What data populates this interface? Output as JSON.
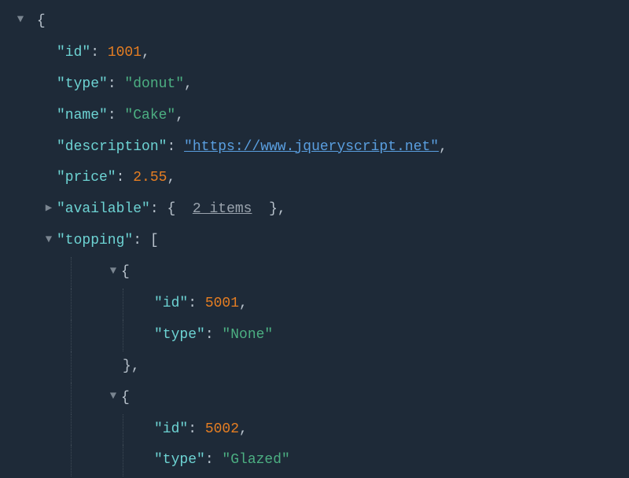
{
  "root": {
    "open_brace": "{",
    "entries": [
      {
        "key": "\"id\"",
        "sep": ": ",
        "value": "1001",
        "valueClass": "num",
        "comma": ","
      },
      {
        "key": "\"type\"",
        "sep": ": ",
        "value": "\"donut\"",
        "valueClass": "str",
        "comma": ","
      },
      {
        "key": "\"name\"",
        "sep": ": ",
        "value": "\"Cake\"",
        "valueClass": "str",
        "comma": ","
      },
      {
        "key": "\"description\"",
        "sep": ": ",
        "value": "\"https://www.jqueryscript.net\"",
        "valueClass": "link",
        "comma": ","
      },
      {
        "key": "\"price\"",
        "sep": ": ",
        "value": "2.55",
        "valueClass": "num",
        "comma": ","
      }
    ],
    "available": {
      "key": "\"available\"",
      "sep": ": ",
      "open": "{",
      "count": "2 items",
      "close": "}",
      "comma": ","
    },
    "topping": {
      "key": "\"topping\"",
      "sep": ": ",
      "open": "[",
      "items": [
        {
          "open": "{",
          "entries": [
            {
              "key": "\"id\"",
              "sep": ": ",
              "value": "5001",
              "valueClass": "num",
              "comma": ","
            },
            {
              "key": "\"type\"",
              "sep": ": ",
              "value": "\"None\"",
              "valueClass": "str",
              "comma": ""
            }
          ],
          "close": "}",
          "comma": ","
        },
        {
          "open": "{",
          "entries": [
            {
              "key": "\"id\"",
              "sep": ": ",
              "value": "5002",
              "valueClass": "num",
              "comma": ","
            },
            {
              "key": "\"type\"",
              "sep": ": ",
              "value": "\"Glazed\"",
              "valueClass": "str",
              "comma": ""
            }
          ],
          "close": "",
          "comma": ""
        }
      ]
    }
  }
}
